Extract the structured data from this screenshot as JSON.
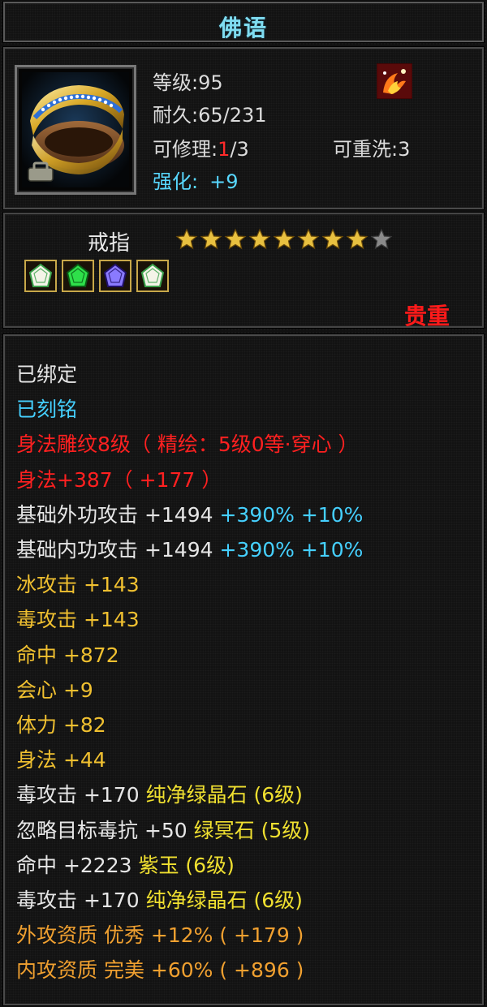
{
  "title": "佛语",
  "item": {
    "level_label": "等级",
    "level_value": ":95",
    "durability_label": "耐久",
    "durability_value": ":65/231",
    "repair_label": "可修理:",
    "repair_current": "1",
    "repair_total": "/3",
    "rewash_label": "可重洗",
    "rewash_value": ":3",
    "enhance_label": "强化:",
    "enhance_value": "+9",
    "type": "戒指",
    "stars_filled": 8,
    "stars_total": 9,
    "gems": [
      "white-gem-icon",
      "green-gem-icon",
      "purple-gem-icon",
      "white-gem-icon"
    ],
    "quality": "贵重"
  },
  "stats": [
    {
      "parts": [
        {
          "t": "已绑定",
          "c": "white"
        }
      ]
    },
    {
      "parts": [
        {
          "t": "已刻铭",
          "c": "cyan"
        }
      ]
    },
    {
      "parts": [
        {
          "t": "身法雕纹8级（ 精绘：5级0等·穿心 ）",
          "c": "red"
        }
      ]
    },
    {
      "parts": [
        {
          "t": "身法+387（ +177 ）",
          "c": "red"
        }
      ]
    },
    {
      "parts": [
        {
          "t": "基础外功攻击 +1494 ",
          "c": "white"
        },
        {
          "t": "+390% +10%",
          "c": "cyan"
        }
      ]
    },
    {
      "parts": [
        {
          "t": "基础内功攻击 +1494 ",
          "c": "white"
        },
        {
          "t": "+390% +10%",
          "c": "cyan"
        }
      ]
    },
    {
      "parts": [
        {
          "t": "冰攻击 +143",
          "c": "gold"
        }
      ]
    },
    {
      "parts": [
        {
          "t": "毒攻击 +143",
          "c": "gold"
        }
      ]
    },
    {
      "parts": [
        {
          "t": "命中 +872",
          "c": "gold"
        }
      ]
    },
    {
      "parts": [
        {
          "t": "会心 +9",
          "c": "gold"
        }
      ]
    },
    {
      "parts": [
        {
          "t": "体力 +82",
          "c": "gold"
        }
      ]
    },
    {
      "parts": [
        {
          "t": "身法 +44",
          "c": "gold"
        }
      ]
    },
    {
      "parts": [
        {
          "t": "毒攻击 +170 ",
          "c": "white"
        },
        {
          "t": "纯净绿晶石 (6级)",
          "c": "yellow"
        }
      ]
    },
    {
      "parts": [
        {
          "t": "忽略目标毒抗 +50 ",
          "c": "white"
        },
        {
          "t": "绿冥石 (5级)",
          "c": "yellow"
        }
      ]
    },
    {
      "parts": [
        {
          "t": "命中 +2223 ",
          "c": "white"
        },
        {
          "t": "紫玉 (6级)",
          "c": "yellow"
        }
      ]
    },
    {
      "parts": [
        {
          "t": "毒攻击 +170 ",
          "c": "white"
        },
        {
          "t": "纯净绿晶石 (6级)",
          "c": "yellow"
        }
      ]
    },
    {
      "parts": [
        {
          "t": "外攻资质  优秀 +12% ( +179 )",
          "c": "orange"
        }
      ]
    },
    {
      "parts": [
        {
          "t": "内攻资质  完美 +60% ( +896 )",
          "c": "orange"
        }
      ]
    }
  ],
  "colors": {
    "title": "#7fdcf0",
    "bound": "#e6e6e6",
    "engraved": "#45d0ff",
    "red": "#ff2020",
    "gold": "#f0c030",
    "gem_yellow": "#f0e030",
    "aptitude_orange": "#f0a030",
    "quality_red": "#ff1a1a"
  }
}
